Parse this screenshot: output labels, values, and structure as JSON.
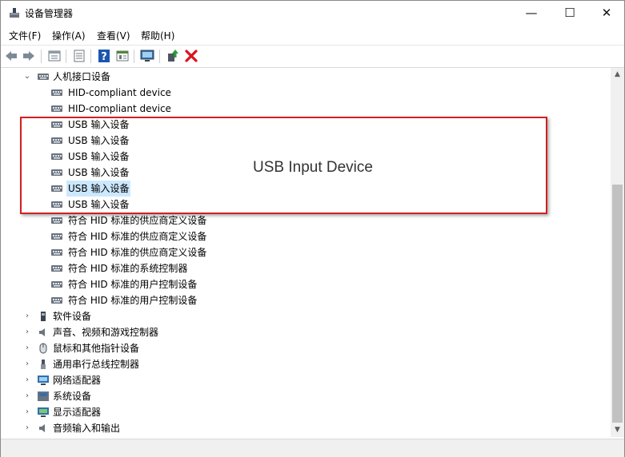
{
  "window": {
    "title": "设备管理器",
    "minimize_glyph": "—",
    "maximize_glyph": "☐",
    "close_glyph": "✕"
  },
  "menubar": {
    "items": [
      "文件(F)",
      "操作(A)",
      "查看(V)",
      "帮助(H)"
    ]
  },
  "toolbar": {
    "buttons": [
      "back-arrow-icon",
      "forward-arrow-icon",
      "properties-view-icon",
      "update-list-icon",
      "help-icon",
      "properties-icon",
      "monitor-scan-icon",
      "enable-device-icon",
      "uninstall-x-icon"
    ],
    "uninstall_color": "#d9141c",
    "help_color": "#1a56b0"
  },
  "tree": {
    "category_open": {
      "label": "人机接口设备",
      "expander": "⌄"
    },
    "children": [
      "HID-compliant device",
      "HID-compliant device",
      "USB 输入设备",
      "USB 输入设备",
      "USB 输入设备",
      "USB 输入设备",
      "USB 输入设备",
      "USB 输入设备",
      "符合 HID 标准的供应商定义设备",
      "符合 HID 标准的供应商定义设备",
      "符合 HID 标准的供应商定义设备",
      "符合 HID 标准的系统控制器",
      "符合 HID 标准的用户控制设备",
      "符合 HID 标准的用户控制设备"
    ],
    "selected_index": 6,
    "categories": [
      {
        "label": "软件设备",
        "icon": "software-device-icon"
      },
      {
        "label": "声音、视频和游戏控制器",
        "icon": "speaker-icon"
      },
      {
        "label": "鼠标和其他指针设备",
        "icon": "mouse-icon"
      },
      {
        "label": "通用串行总线控制器",
        "icon": "usb-connector-icon"
      },
      {
        "label": "网络适配器",
        "icon": "network-adapter-icon"
      },
      {
        "label": "系统设备",
        "icon": "system-device-icon"
      },
      {
        "label": "显示适配器",
        "icon": "display-adapter-icon"
      },
      {
        "label": "音频输入和输出",
        "icon": "audio-io-icon"
      }
    ],
    "collapsed_expander": "›"
  },
  "scrollbar": {
    "up": "▲",
    "down": "▼"
  },
  "annotation": {
    "text": "USB Input Device",
    "border_color": "#d02020"
  }
}
